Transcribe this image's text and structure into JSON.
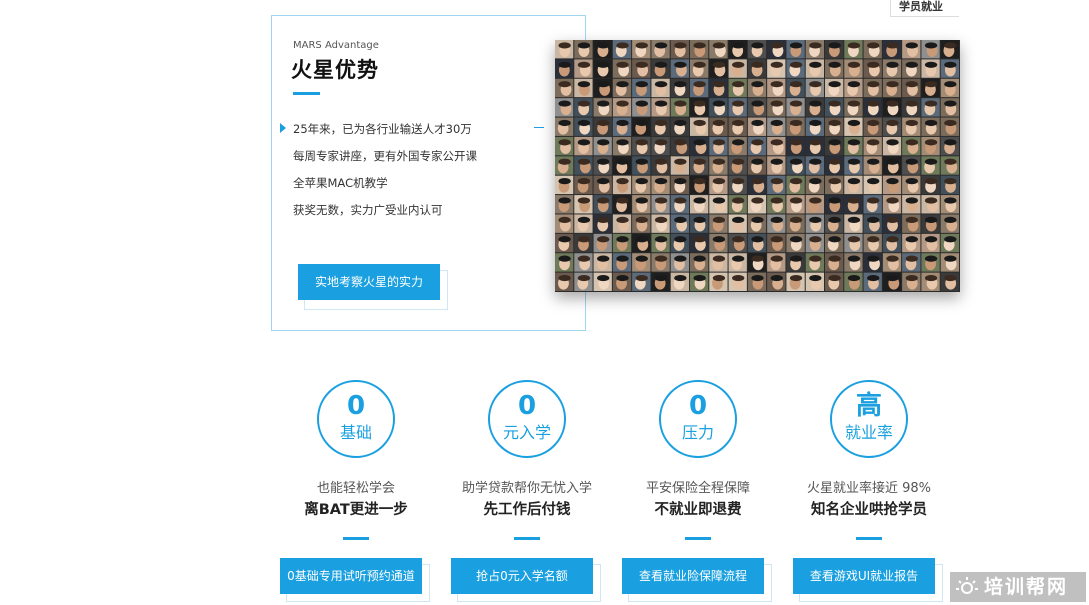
{
  "top_nav": {
    "item": "学员就业"
  },
  "advantage": {
    "eyebrow": "MARS Advantage",
    "title": "火星优势",
    "points": [
      "25年来，已为各行业输送人才30万",
      "每周专家讲座，更有外国专家公开课",
      "全苹果MAC机教学",
      "获奖无数，实力广受业内认可"
    ],
    "cta": "实地考察火星的实力"
  },
  "features": [
    {
      "big": "0",
      "small": "基础",
      "line1": "也能轻松学会",
      "line2": "离BAT更进一步",
      "button": "0基础专用试听预约通道"
    },
    {
      "big": "0",
      "small": "元入学",
      "line1": "助学贷款帮你无忧入学",
      "line2": "先工作后付钱",
      "button": "抢占0元入学名额"
    },
    {
      "big": "0",
      "small": "压力",
      "line1": "平安保险全程保障",
      "line2": "不就业即退费",
      "button": "查看就业险保障流程"
    },
    {
      "big": "高",
      "small": "就业率",
      "line1": "火星就业率接近 98%",
      "line2": "知名企业哄抢学员",
      "button": "查看游戏UI就业报告"
    }
  ],
  "watermark": {
    "text": "培训帮网",
    "icon": "sun-icon"
  },
  "colors": {
    "accent": "#1aa0e0"
  }
}
